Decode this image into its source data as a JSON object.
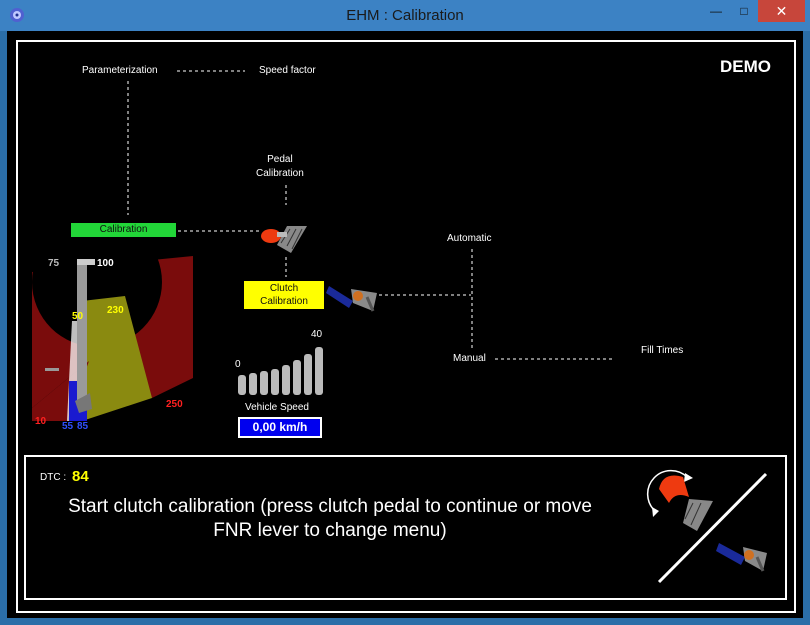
{
  "window": {
    "title": "EHM : Calibration",
    "minimize_glyph": "—",
    "maximize_glyph": "□",
    "close_glyph": "✕"
  },
  "badge": "DEMO",
  "menu": {
    "parameterization": "Parameterization",
    "speed_factor": "Speed factor",
    "pedal_calibration_line1": "Pedal",
    "pedal_calibration_line2": "Calibration",
    "calibration": "Calibration",
    "clutch_calibration_line1": "Clutch",
    "clutch_calibration_line2": "Calibration",
    "automatic": "Automatic",
    "manual": "Manual",
    "fill_times": "Fill Times"
  },
  "gauge": {
    "labels": [
      "75",
      "100",
      "50",
      "230",
      "10",
      "55",
      "85",
      "250"
    ],
    "label_colors": [
      "#bbbbbb",
      "#ffffff",
      "#ffff00",
      "#ffff00",
      "#ff2020",
      "#3050ff",
      "#3050ff",
      "#ff2020"
    ]
  },
  "vehicle_speed": {
    "label": "Vehicle Speed",
    "value": "0,00 km/h",
    "scale_min": "0",
    "scale_max": "40",
    "bar_count": 8
  },
  "dtc": {
    "label": "DTC :",
    "value": "84"
  },
  "message_line1": "Start clutch calibration (press clutch pedal to continue or move",
  "message_line2": "FNR lever to change menu)",
  "colors": {
    "calibration_button": "#22d638",
    "clutch_button": "#ffff00",
    "speed_box": "#0000ee",
    "dtc_value": "#ffff00",
    "gauge_red": "#7a0c0c",
    "gauge_yellow": "#8a8a10"
  },
  "icons": [
    "app-icon",
    "pedal-icon",
    "clutch-lever-icon",
    "rotate-pedal-icon"
  ]
}
